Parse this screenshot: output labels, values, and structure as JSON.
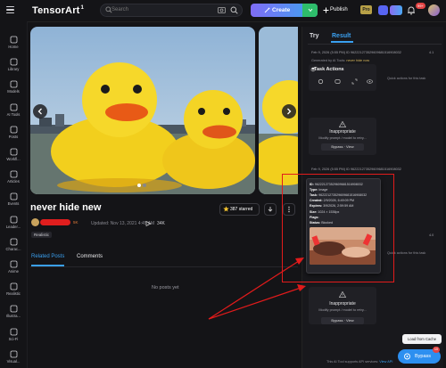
{
  "header": {
    "logo": "TensorArt",
    "logo_sup": "1",
    "search_placeholder": "Search",
    "create_label": "Create",
    "publish_label": "Publish",
    "pro_badge": "Pro",
    "notification_count": "99+"
  },
  "sidebar": {
    "items": [
      {
        "label": "Home",
        "icon": "home-icon"
      },
      {
        "label": "Library",
        "icon": "library-icon"
      },
      {
        "label": "Models",
        "icon": "models-icon"
      },
      {
        "label": "AI Tools",
        "icon": "ai-tools-icon"
      },
      {
        "label": "Posts",
        "icon": "posts-icon"
      },
      {
        "label": "Workfl...",
        "icon": "workflow-icon"
      },
      {
        "label": "Articles",
        "icon": "articles-icon"
      },
      {
        "label": "Events",
        "icon": "events-icon"
      },
      {
        "label": "Leader...",
        "icon": "leaderboard-icon"
      },
      {
        "label": "Charac...",
        "icon": "character-icon"
      },
      {
        "label": "Anime",
        "icon": "anime-icon"
      },
      {
        "label": "Realistic",
        "icon": "realistic-icon"
      },
      {
        "label": "Illustra...",
        "icon": "illustration-icon"
      },
      {
        "label": "Sci-Fi",
        "icon": "scifi-icon"
      },
      {
        "label": "Visual...",
        "icon": "visual-icon"
      }
    ]
  },
  "post": {
    "title": "never hide new",
    "author_tag": "5K",
    "updated": "Updated: Nov 13, 2021 4:45 AM",
    "views": "34K",
    "star_label": "387 starred",
    "chip": "Realistic",
    "tabs": [
      "Related Posts",
      "Comments"
    ],
    "empty_text": "No posts yet"
  },
  "panel": {
    "tab_try": "Try",
    "tab_result": "Result",
    "task1": {
      "time": "Feb 9, 2026 (5:55 PM) ID 962221273529609681516908032",
      "version": "4.1",
      "generated_prefix": "Generated by AI Tools:",
      "generated_tool": "never hide now"
    },
    "task_actions_title": "Task Actions",
    "quick_actions": "Quick actions for this task",
    "inappropriate_title": "Inappropriate",
    "inappropriate_sub": "Modify prompt / model to retry...",
    "bypass_button": "Bypass · View",
    "task2": {
      "time": "Feb 9, 2026 (5:55 PM) ID 962221273529609681516908032",
      "version": "4.0"
    }
  },
  "popup": {
    "lines": [
      {
        "k": "ID:",
        "v": "962221273529609681516908032"
      },
      {
        "k": "Type:",
        "v": "Image"
      },
      {
        "k": "Task:",
        "v": "962221273529609681516908032"
      },
      {
        "k": "Created:",
        "v": "2/9/2026, 6:49:09 PM"
      },
      {
        "k": "Expires:",
        "v": "3/9/2026, 2:59:59 AM"
      },
      {
        "k": "Size:",
        "v": "1024 × 1536px"
      },
      {
        "k": "Flags:",
        "v": ""
      },
      {
        "k": "Status:",
        "v": "Blocked"
      }
    ]
  },
  "footer": {
    "load_from_cache": "Load from Cache",
    "bypass_fab": "Bypass",
    "fab_badge": "10",
    "text_prefix": "This AI Tool supports API services:",
    "text_link": "View API"
  },
  "colors": {
    "accent": "#3aa0f0",
    "annotation_red": "#e21b1b",
    "create_gradient": [
      "#7f6cf5",
      "#3da4f0"
    ]
  }
}
